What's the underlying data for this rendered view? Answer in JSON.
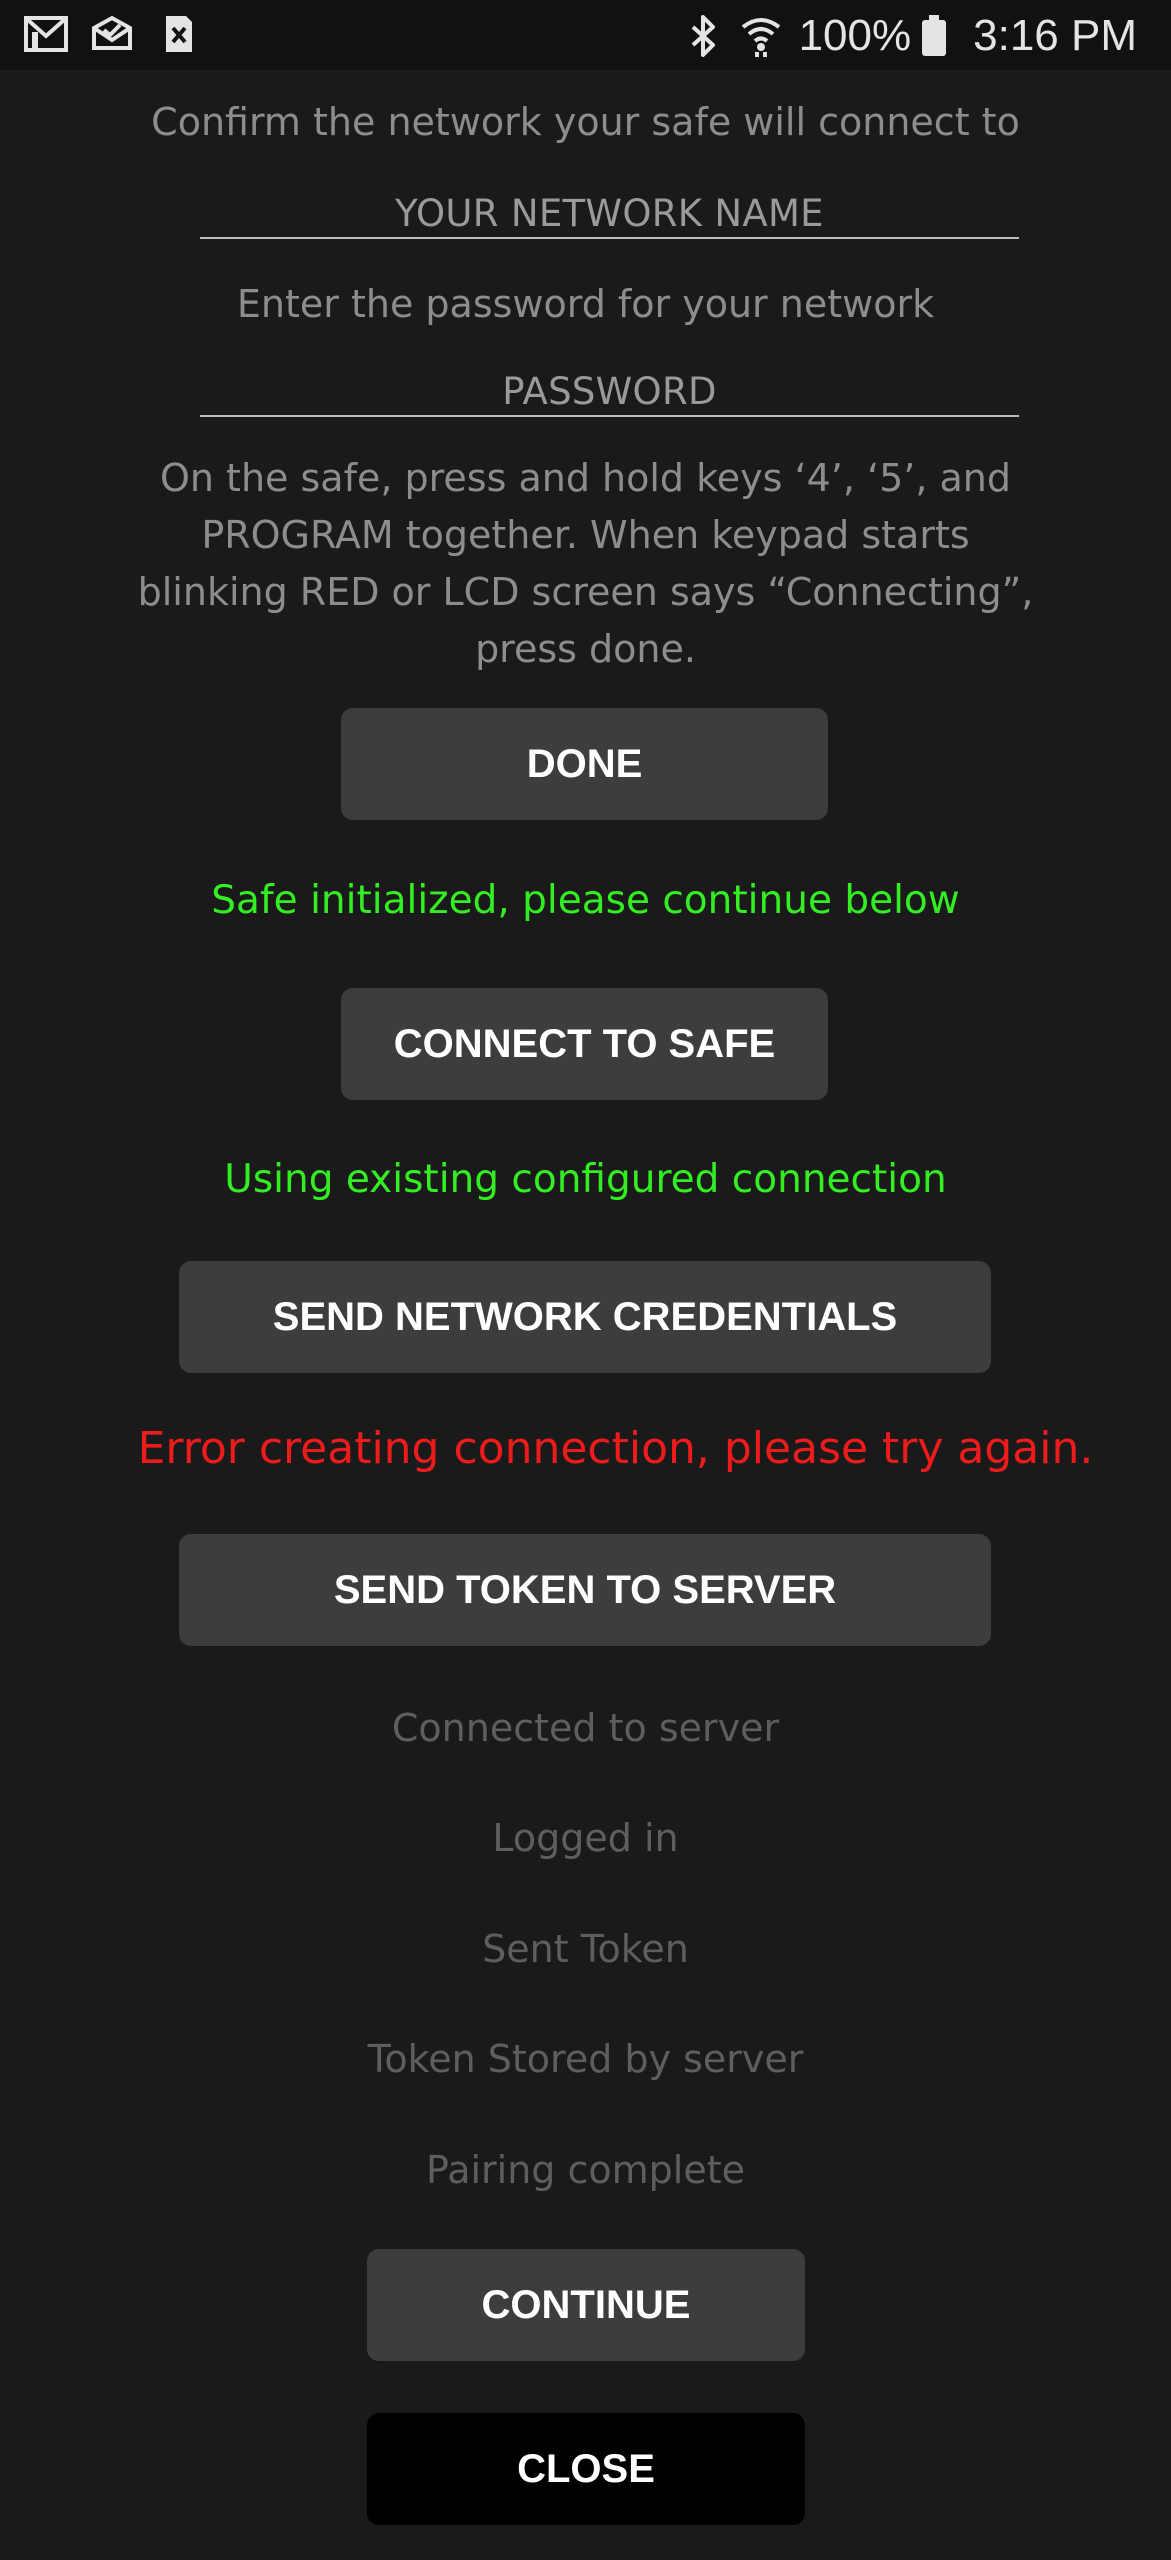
{
  "status_bar": {
    "left_icons": [
      "gmail-icon",
      "inbox-icon",
      "sim-error-icon"
    ],
    "battery": "100%",
    "time": "3:16 PM"
  },
  "setup": {
    "network_prompt": "Confirm the network your safe will connect to",
    "network_name_value": "YOUR NETWORK NAME",
    "password_prompt": "Enter the password for your network",
    "password_value": "PASSWORD",
    "instructions_line1": "On the safe, press and hold keys ‘4’, ‘5’, and",
    "instructions_line2": "PROGRAM together. When keypad starts",
    "instructions_line3": "blinking RED or LCD screen says “Connecting”,",
    "instructions_line4": "press done."
  },
  "steps": {
    "done_label": "DONE",
    "done_status": "Safe initialized, please continue below",
    "connect_label": "CONNECT TO SAFE",
    "connect_status": "Using existing configured connection",
    "credentials_label": "SEND NETWORK CREDENTIALS",
    "credentials_status": "Error creating connection, please try again.",
    "token_label": "SEND TOKEN TO SERVER"
  },
  "progress": {
    "items": [
      "Connected to server",
      "Logged in",
      "Sent Token",
      "Token Stored by server",
      "Pairing complete"
    ]
  },
  "footer": {
    "continue_label": "CONTINUE",
    "close_label": "CLOSE"
  },
  "colors": {
    "success": "#33ee22",
    "error": "#ee1b1b",
    "button_bg": "#3d3d3d",
    "background": "#1a1a1a"
  }
}
